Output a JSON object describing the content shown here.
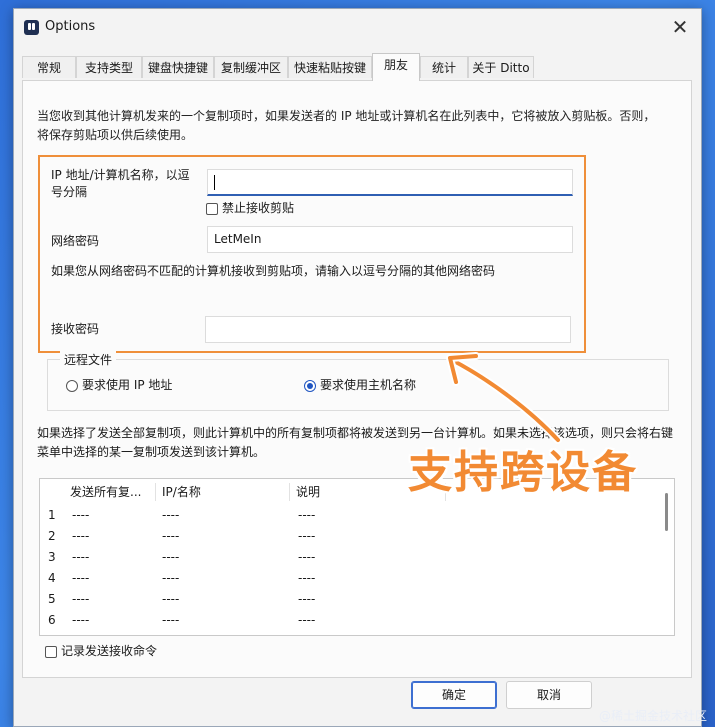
{
  "window": {
    "title": "Options"
  },
  "tabs": [
    {
      "label": "常规"
    },
    {
      "label": "支持类型"
    },
    {
      "label": "键盘快捷键"
    },
    {
      "label": "复制缓冲区"
    },
    {
      "label": "快速粘贴按键"
    },
    {
      "label": "朋友",
      "active": true
    },
    {
      "label": "统计"
    },
    {
      "label": "关于 Ditto"
    }
  ],
  "friends": {
    "description": "当您收到其他计算机发来的一个复制项时，如果发送者的 IP 地址或计算机名在此列表中，它将被放入剪贴板。否则，将保存剪贴项以供后续使用。",
    "ip_label": "IP 地址/计算机名称，以逗号分隔",
    "ip_value": "",
    "disable_receive_label": "禁止接收剪贴",
    "network_password_label": "网络密码",
    "network_password_value": "LetMeIn",
    "mismatch_hint": "如果您从网络密码不匹配的计算机接收到剪贴项，请输入以逗号分隔的其他网络密码",
    "receive_password_label": "接收密码",
    "receive_password_value": "",
    "remote_files": {
      "legend": "远程文件",
      "use_ip_label": "要求使用 IP 地址",
      "use_hostname_label": "要求使用主机名称",
      "selected": "use_hostname"
    },
    "send_description": "如果选择了发送全部复制项，则此计算机中的所有复制项都将被发送到另一台计算机。如果未选择该选项，则只会将右键菜单中选择的某一复制项发送到该计算机。",
    "list_columns": [
      "发送所有复...",
      "IP/名称",
      "说明"
    ],
    "list_rows": [
      {
        "index": "1",
        "send_all": "----",
        "ip": "----",
        "desc": "----"
      },
      {
        "index": "2",
        "send_all": "----",
        "ip": "----",
        "desc": "----"
      },
      {
        "index": "3",
        "send_all": "----",
        "ip": "----",
        "desc": "----"
      },
      {
        "index": "4",
        "send_all": "----",
        "ip": "----",
        "desc": "----"
      },
      {
        "index": "5",
        "send_all": "----",
        "ip": "----",
        "desc": "----"
      },
      {
        "index": "6",
        "send_all": "----",
        "ip": "----",
        "desc": "----"
      }
    ],
    "log_commands_label": "记录发送接收命令"
  },
  "buttons": {
    "ok": "确定",
    "cancel": "取消"
  },
  "annotation": {
    "text": "支持跨设备",
    "color": "#f28a33"
  },
  "watermark": "@稀土掘金技术社区"
}
